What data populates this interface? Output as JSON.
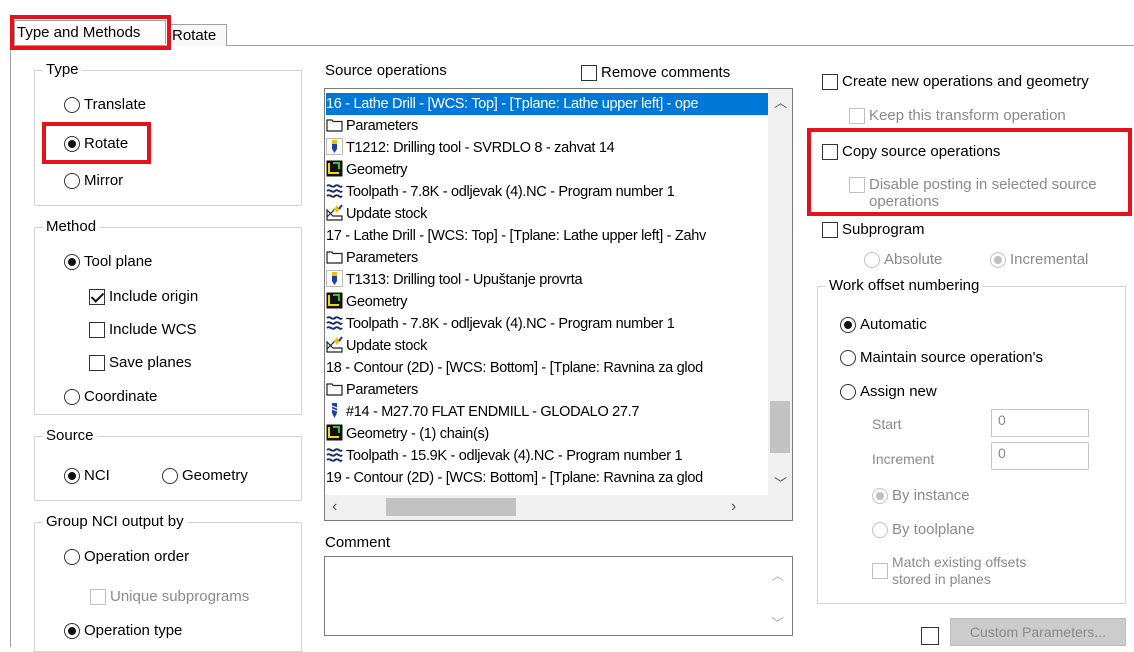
{
  "tabs": {
    "active": "Type and Methods",
    "inactive": "Rotate"
  },
  "type_group": {
    "title": "Type",
    "translate": "Translate",
    "rotate": "Rotate",
    "mirror": "Mirror",
    "selected": "Rotate"
  },
  "method_group": {
    "title": "Method",
    "tool_plane": "Tool plane",
    "include_origin": "Include origin",
    "include_origin_checked": true,
    "include_wcs": "Include WCS",
    "save_planes": "Save planes",
    "coordinate": "Coordinate",
    "selected": "Tool plane"
  },
  "source_group": {
    "title": "Source",
    "nci": "NCI",
    "geometry": "Geometry",
    "selected": "NCI"
  },
  "group_nci": {
    "title": "Group NCI output by",
    "operation_order": "Operation order",
    "unique_subprograms": "Unique subprograms",
    "operation_type": "Operation type",
    "selected": "Operation type"
  },
  "source_ops": {
    "label": "Source operations",
    "remove_comments": "Remove comments",
    "items": [
      {
        "text": "16 - Lathe Drill - [WCS: Top] - [Tplane: Lathe upper left] - ope",
        "icon": "none",
        "selected": true
      },
      {
        "text": "Parameters",
        "icon": "folder-icon"
      },
      {
        "text": "T1212: Drilling tool - SVRDLO 8 - zahvat 14",
        "icon": "drill-tool-icon"
      },
      {
        "text": "Geometry",
        "icon": "geometry-icon"
      },
      {
        "text": "Toolpath - 7.8K - odljevak (4).NC - Program number 1",
        "icon": "toolpath-icon"
      },
      {
        "text": "Update stock",
        "icon": "update-stock-icon"
      },
      {
        "text": "17 - Lathe Drill - [WCS: Top] - [Tplane: Lathe upper left] - Zahv",
        "icon": "none"
      },
      {
        "text": "Parameters",
        "icon": "folder-icon"
      },
      {
        "text": "T1313: Drilling tool - Upuštanje provrta",
        "icon": "drill-tool-icon"
      },
      {
        "text": "Geometry",
        "icon": "geometry-icon"
      },
      {
        "text": "Toolpath - 7.8K - odljevak (4).NC - Program number 1",
        "icon": "toolpath-icon"
      },
      {
        "text": "Update stock",
        "icon": "update-stock-icon"
      },
      {
        "text": "18 - Contour (2D) - [WCS: Bottom] - [Tplane: Ravnina za glod",
        "icon": "none"
      },
      {
        "text": "Parameters",
        "icon": "folder-icon"
      },
      {
        "text": "#14 - M27.70 FLAT ENDMILL - GLODALO 27.7",
        "icon": "endmill-icon"
      },
      {
        "text": "Geometry - (1) chain(s)",
        "icon": "geometry-icon"
      },
      {
        "text": "Toolpath - 15.9K - odljevak (4).NC - Program number 1",
        "icon": "toolpath-icon"
      },
      {
        "text": "19 - Contour (2D) - [WCS: Bottom] - [Tplane: Ravnina za glod",
        "icon": "none"
      }
    ]
  },
  "comment": {
    "label": "Comment",
    "value": ""
  },
  "right": {
    "create_new": "Create new operations and geometry",
    "keep_transform": "Keep this transform operation",
    "copy_source": "Copy source operations",
    "disable_posting_1": "Disable posting in selected source",
    "disable_posting_2": "operations",
    "subprogram": "Subprogram",
    "absolute": "Absolute",
    "incremental": "Incremental",
    "work_offset": {
      "title": "Work offset numbering",
      "automatic": "Automatic",
      "maintain": "Maintain source operation's",
      "assign_new": "Assign new",
      "selected": "Automatic",
      "start_label": "Start",
      "start_value": "0",
      "increment_label": "Increment",
      "increment_value": "0",
      "by_instance": "By instance",
      "by_toolplane": "By toolplane",
      "match_1": "Match existing offsets",
      "match_2": "stored in planes"
    },
    "custom_params": "Custom Parameters..."
  },
  "colors": {
    "highlight_red": "#e6121b",
    "selection_blue": "#0078d7"
  }
}
